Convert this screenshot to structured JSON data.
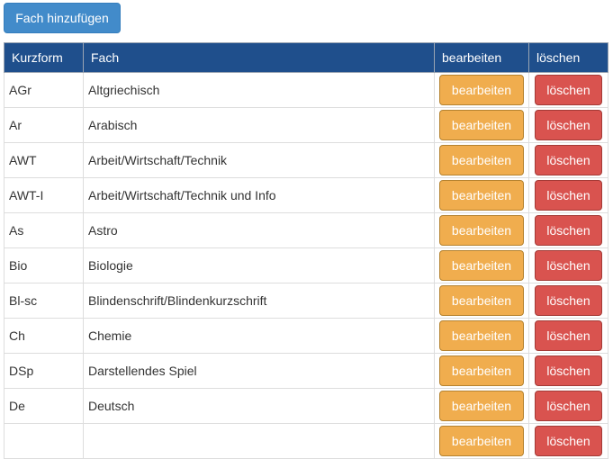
{
  "toolbar": {
    "add_label": "Fach hinzufügen"
  },
  "table": {
    "headers": {
      "short": "Kurzform",
      "subject": "Fach",
      "edit": "bearbeiten",
      "delete": "löschen"
    },
    "edit_label": "bearbeiten",
    "delete_label": "löschen",
    "rows": [
      {
        "short": "AGr",
        "subject": "Altgriechisch"
      },
      {
        "short": "Ar",
        "subject": "Arabisch"
      },
      {
        "short": "AWT",
        "subject": "Arbeit/Wirtschaft/Technik"
      },
      {
        "short": "AWT-I",
        "subject": "Arbeit/Wirtschaft/Technik und Info"
      },
      {
        "short": "As",
        "subject": "Astro"
      },
      {
        "short": "Bio",
        "subject": "Biologie"
      },
      {
        "short": "Bl-sc",
        "subject": "Blindenschrift/Blindenkurzschrift"
      },
      {
        "short": "Ch",
        "subject": "Chemie"
      },
      {
        "short": "DSp",
        "subject": "Darstellendes Spiel"
      },
      {
        "short": "De",
        "subject": "Deutsch"
      },
      {
        "short": "",
        "subject": ""
      }
    ]
  },
  "colors": {
    "header_bg": "#1f4f8c",
    "primary": "#428bca",
    "warning": "#f0ad4e",
    "danger": "#d9534f"
  }
}
